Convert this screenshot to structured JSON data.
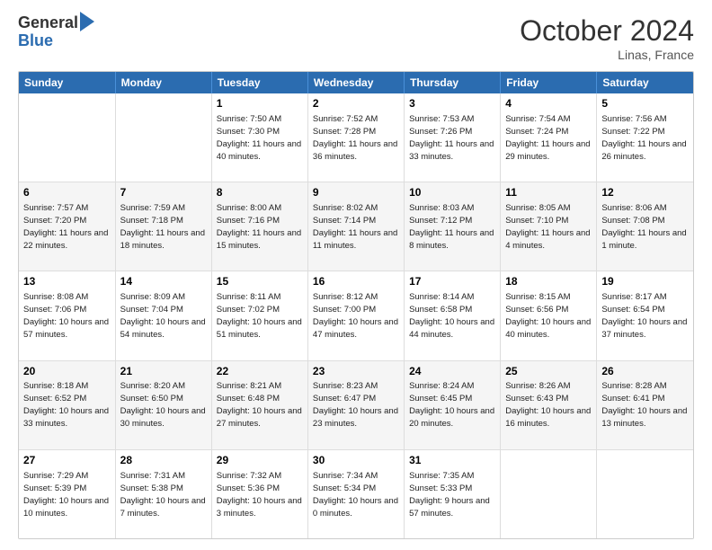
{
  "logo": {
    "general": "General",
    "blue": "Blue"
  },
  "header": {
    "month": "October 2024",
    "location": "Linas, France"
  },
  "days": [
    "Sunday",
    "Monday",
    "Tuesday",
    "Wednesday",
    "Thursday",
    "Friday",
    "Saturday"
  ],
  "weeks": [
    [
      {
        "day": "",
        "sunrise": "",
        "sunset": "",
        "daylight": ""
      },
      {
        "day": "",
        "sunrise": "",
        "sunset": "",
        "daylight": ""
      },
      {
        "day": "1",
        "sunrise": "Sunrise: 7:50 AM",
        "sunset": "Sunset: 7:30 PM",
        "daylight": "Daylight: 11 hours and 40 minutes."
      },
      {
        "day": "2",
        "sunrise": "Sunrise: 7:52 AM",
        "sunset": "Sunset: 7:28 PM",
        "daylight": "Daylight: 11 hours and 36 minutes."
      },
      {
        "day": "3",
        "sunrise": "Sunrise: 7:53 AM",
        "sunset": "Sunset: 7:26 PM",
        "daylight": "Daylight: 11 hours and 33 minutes."
      },
      {
        "day": "4",
        "sunrise": "Sunrise: 7:54 AM",
        "sunset": "Sunset: 7:24 PM",
        "daylight": "Daylight: 11 hours and 29 minutes."
      },
      {
        "day": "5",
        "sunrise": "Sunrise: 7:56 AM",
        "sunset": "Sunset: 7:22 PM",
        "daylight": "Daylight: 11 hours and 26 minutes."
      }
    ],
    [
      {
        "day": "6",
        "sunrise": "Sunrise: 7:57 AM",
        "sunset": "Sunset: 7:20 PM",
        "daylight": "Daylight: 11 hours and 22 minutes."
      },
      {
        "day": "7",
        "sunrise": "Sunrise: 7:59 AM",
        "sunset": "Sunset: 7:18 PM",
        "daylight": "Daylight: 11 hours and 18 minutes."
      },
      {
        "day": "8",
        "sunrise": "Sunrise: 8:00 AM",
        "sunset": "Sunset: 7:16 PM",
        "daylight": "Daylight: 11 hours and 15 minutes."
      },
      {
        "day": "9",
        "sunrise": "Sunrise: 8:02 AM",
        "sunset": "Sunset: 7:14 PM",
        "daylight": "Daylight: 11 hours and 11 minutes."
      },
      {
        "day": "10",
        "sunrise": "Sunrise: 8:03 AM",
        "sunset": "Sunset: 7:12 PM",
        "daylight": "Daylight: 11 hours and 8 minutes."
      },
      {
        "day": "11",
        "sunrise": "Sunrise: 8:05 AM",
        "sunset": "Sunset: 7:10 PM",
        "daylight": "Daylight: 11 hours and 4 minutes."
      },
      {
        "day": "12",
        "sunrise": "Sunrise: 8:06 AM",
        "sunset": "Sunset: 7:08 PM",
        "daylight": "Daylight: 11 hours and 1 minute."
      }
    ],
    [
      {
        "day": "13",
        "sunrise": "Sunrise: 8:08 AM",
        "sunset": "Sunset: 7:06 PM",
        "daylight": "Daylight: 10 hours and 57 minutes."
      },
      {
        "day": "14",
        "sunrise": "Sunrise: 8:09 AM",
        "sunset": "Sunset: 7:04 PM",
        "daylight": "Daylight: 10 hours and 54 minutes."
      },
      {
        "day": "15",
        "sunrise": "Sunrise: 8:11 AM",
        "sunset": "Sunset: 7:02 PM",
        "daylight": "Daylight: 10 hours and 51 minutes."
      },
      {
        "day": "16",
        "sunrise": "Sunrise: 8:12 AM",
        "sunset": "Sunset: 7:00 PM",
        "daylight": "Daylight: 10 hours and 47 minutes."
      },
      {
        "day": "17",
        "sunrise": "Sunrise: 8:14 AM",
        "sunset": "Sunset: 6:58 PM",
        "daylight": "Daylight: 10 hours and 44 minutes."
      },
      {
        "day": "18",
        "sunrise": "Sunrise: 8:15 AM",
        "sunset": "Sunset: 6:56 PM",
        "daylight": "Daylight: 10 hours and 40 minutes."
      },
      {
        "day": "19",
        "sunrise": "Sunrise: 8:17 AM",
        "sunset": "Sunset: 6:54 PM",
        "daylight": "Daylight: 10 hours and 37 minutes."
      }
    ],
    [
      {
        "day": "20",
        "sunrise": "Sunrise: 8:18 AM",
        "sunset": "Sunset: 6:52 PM",
        "daylight": "Daylight: 10 hours and 33 minutes."
      },
      {
        "day": "21",
        "sunrise": "Sunrise: 8:20 AM",
        "sunset": "Sunset: 6:50 PM",
        "daylight": "Daylight: 10 hours and 30 minutes."
      },
      {
        "day": "22",
        "sunrise": "Sunrise: 8:21 AM",
        "sunset": "Sunset: 6:48 PM",
        "daylight": "Daylight: 10 hours and 27 minutes."
      },
      {
        "day": "23",
        "sunrise": "Sunrise: 8:23 AM",
        "sunset": "Sunset: 6:47 PM",
        "daylight": "Daylight: 10 hours and 23 minutes."
      },
      {
        "day": "24",
        "sunrise": "Sunrise: 8:24 AM",
        "sunset": "Sunset: 6:45 PM",
        "daylight": "Daylight: 10 hours and 20 minutes."
      },
      {
        "day": "25",
        "sunrise": "Sunrise: 8:26 AM",
        "sunset": "Sunset: 6:43 PM",
        "daylight": "Daylight: 10 hours and 16 minutes."
      },
      {
        "day": "26",
        "sunrise": "Sunrise: 8:28 AM",
        "sunset": "Sunset: 6:41 PM",
        "daylight": "Daylight: 10 hours and 13 minutes."
      }
    ],
    [
      {
        "day": "27",
        "sunrise": "Sunrise: 7:29 AM",
        "sunset": "Sunset: 5:39 PM",
        "daylight": "Daylight: 10 hours and 10 minutes."
      },
      {
        "day": "28",
        "sunrise": "Sunrise: 7:31 AM",
        "sunset": "Sunset: 5:38 PM",
        "daylight": "Daylight: 10 hours and 7 minutes."
      },
      {
        "day": "29",
        "sunrise": "Sunrise: 7:32 AM",
        "sunset": "Sunset: 5:36 PM",
        "daylight": "Daylight: 10 hours and 3 minutes."
      },
      {
        "day": "30",
        "sunrise": "Sunrise: 7:34 AM",
        "sunset": "Sunset: 5:34 PM",
        "daylight": "Daylight: 10 hours and 0 minutes."
      },
      {
        "day": "31",
        "sunrise": "Sunrise: 7:35 AM",
        "sunset": "Sunset: 5:33 PM",
        "daylight": "Daylight: 9 hours and 57 minutes."
      },
      {
        "day": "",
        "sunrise": "",
        "sunset": "",
        "daylight": ""
      },
      {
        "day": "",
        "sunrise": "",
        "sunset": "",
        "daylight": ""
      }
    ]
  ]
}
